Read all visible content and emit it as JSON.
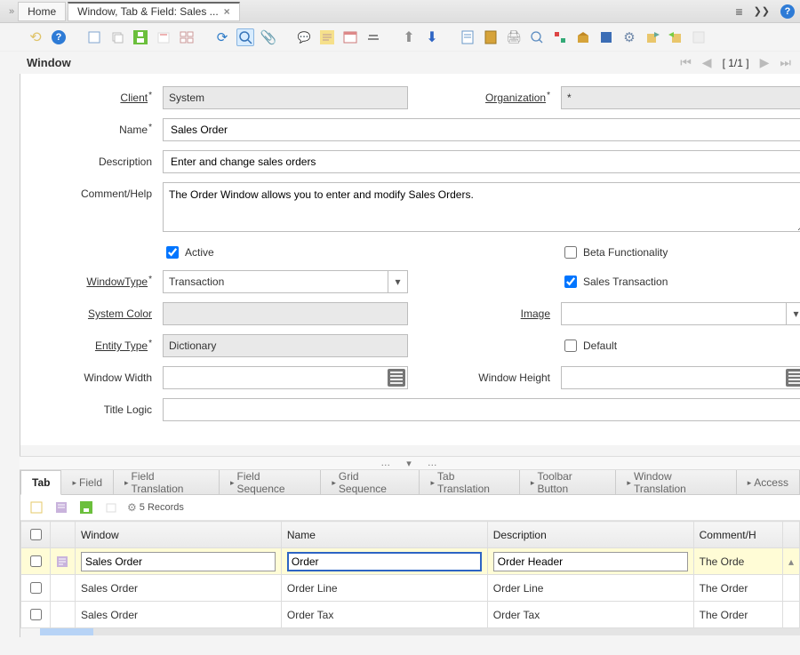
{
  "tabs": {
    "home": "Home",
    "active": "Window, Tab & Field: Sales ..."
  },
  "pager": {
    "text": "[ 1/1 ]"
  },
  "section_title": "Window",
  "form": {
    "client_label": "Client",
    "client_value": "System",
    "org_label": "Organization",
    "org_value": "*",
    "name_label": "Name",
    "name_value": "Sales Order",
    "description_label": "Description",
    "description_value": "Enter and change sales orders",
    "comment_label": "Comment/Help",
    "comment_value": "The Order Window allows you to enter and modify Sales Orders.",
    "active_label": "Active",
    "active_checked": true,
    "beta_label": "Beta Functionality",
    "beta_checked": false,
    "windowtype_label": "WindowType",
    "windowtype_value": "Transaction",
    "salestx_label": "Sales Transaction",
    "salestx_checked": true,
    "syscolor_label": "System Color",
    "syscolor_value": "",
    "image_label": "Image",
    "image_value": "",
    "entitytype_label": "Entity Type",
    "entitytype_value": "Dictionary",
    "default_label": "Default",
    "default_checked": false,
    "wwidth_label": "Window Width",
    "wwidth_value": "",
    "wheight_label": "Window Height",
    "wheight_value": "",
    "titlelogic_label": "Title Logic",
    "titlelogic_value": ""
  },
  "subtabs": [
    "Tab",
    "Field",
    "Field Translation",
    "Field Sequence",
    "Grid Sequence",
    "Tab Translation",
    "Toolbar Button",
    "Window Translation",
    "Access"
  ],
  "grid": {
    "records_text": "5 Records",
    "cols": [
      "Window",
      "Name",
      "Description",
      "Comment/H"
    ],
    "rows": [
      {
        "window": "Sales Order",
        "name": "Order",
        "description": "Order Header",
        "comment": "The Orde",
        "selected": true
      },
      {
        "window": "Sales Order",
        "name": "Order Line",
        "description": "Order Line",
        "comment": "The Order"
      },
      {
        "window": "Sales Order",
        "name": "Order Tax",
        "description": "Order Tax",
        "comment": "The Order"
      }
    ]
  }
}
